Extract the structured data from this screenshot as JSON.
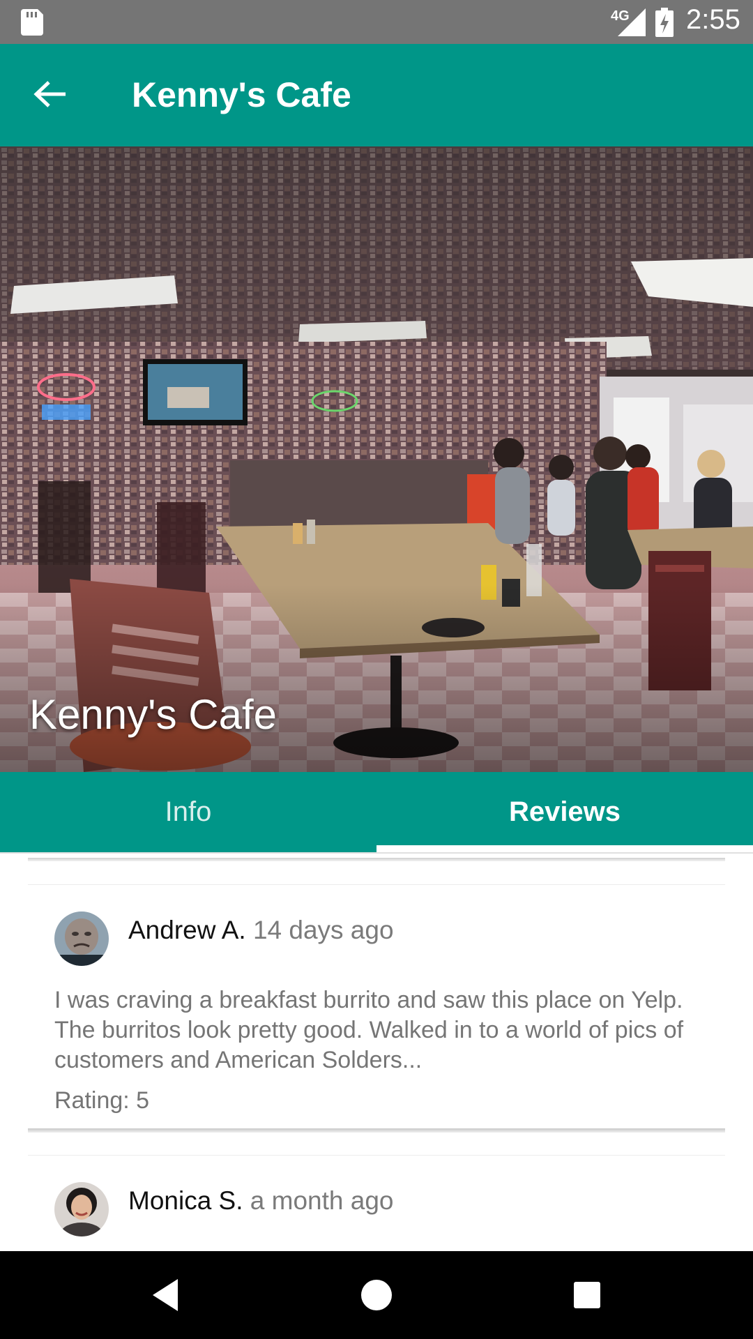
{
  "status_bar": {
    "network": "4G",
    "time": "2:55",
    "icons": [
      "sd-card-icon",
      "signal-icon",
      "battery-charging-icon"
    ]
  },
  "app_bar": {
    "title": "Kenny's Cafe",
    "back_icon": "arrow-left-icon"
  },
  "hero": {
    "title": "Kenny's Cafe"
  },
  "tabs": [
    {
      "label": "Info",
      "selected": false
    },
    {
      "label": "Reviews",
      "selected": true
    }
  ],
  "colors": {
    "primary": "#009688",
    "status_bar": "#757575"
  },
  "reviews": [
    {
      "name": "Andrew A.",
      "date": "14 days ago",
      "text": "I was craving a breakfast burrito and saw this place on Yelp. The burritos look pretty good. Walked in to a world of pics of customers and American Solders...",
      "rating": "Rating: 5"
    },
    {
      "name": "Monica S.",
      "date": "a month ago"
    }
  ],
  "nav_bar": {
    "icons": [
      "nav-back-icon",
      "nav-home-icon",
      "nav-recents-icon"
    ]
  }
}
